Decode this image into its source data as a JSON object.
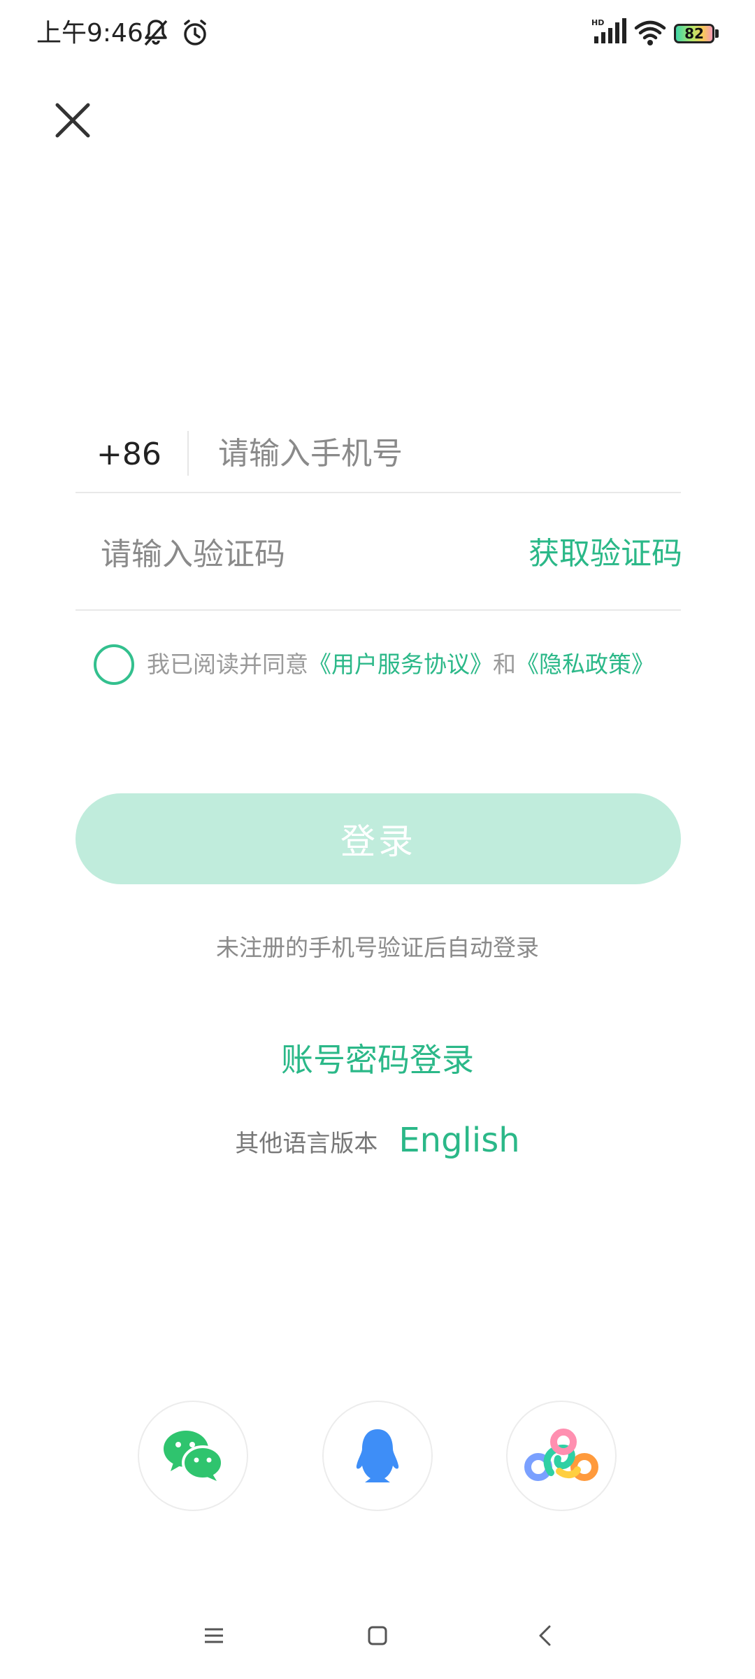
{
  "status_bar": {
    "time": "上午9:46",
    "icons": [
      "mute-bell-icon",
      "alarm-icon",
      "hd-signal-icon",
      "wifi-icon",
      "battery-icon"
    ],
    "signal_label": "HD",
    "battery": "82"
  },
  "close_icon": "close-icon",
  "phone": {
    "country_code": "+86",
    "placeholder": "请输入手机号",
    "value": ""
  },
  "verification": {
    "placeholder": "请输入验证码",
    "value": "",
    "get_code_label": "获取验证码"
  },
  "agreement": {
    "prefix": "我已阅读并同意",
    "user_agreement": "《用户服务协议》",
    "and": "和",
    "privacy_policy": "《隐私政策》",
    "checked": false
  },
  "login_button": "登录",
  "auto_register_hint": "未注册的手机号验证后自动登录",
  "account_password_login": "账号密码登录",
  "language": {
    "label": "其他语言版本",
    "option": "English"
  },
  "social_login": [
    {
      "name": "wechat",
      "icon": "wechat-icon"
    },
    {
      "name": "qq",
      "icon": "qq-penguin-icon"
    },
    {
      "name": "weibo",
      "icon": "colorful-link-icon"
    }
  ],
  "nav_bar": [
    "menu-icon",
    "home-icon",
    "back-icon"
  ],
  "colors": {
    "accent": "#2bb888",
    "button_disabled_bg": "#c0ecdc",
    "divider": "#e8e8e8",
    "placeholder": "#8a8a8a"
  }
}
